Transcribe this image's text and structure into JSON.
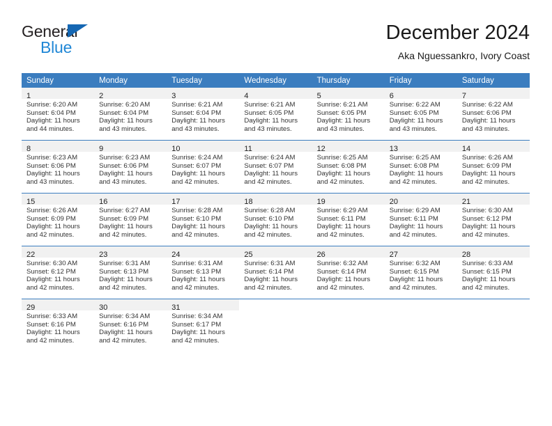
{
  "logo": {
    "word_one": "General",
    "word_two": "Blue",
    "triangle_color": "#1567b3",
    "blue_text_color": "#2087d6"
  },
  "header": {
    "title": "December 2024",
    "subtitle": "Aka Nguessankro, Ivory Coast"
  },
  "theme": {
    "header_blue": "#3b7dbf",
    "date_band_gray": "#f1f1f1",
    "text_dark": "#222222"
  },
  "calendar": {
    "weekday_headers": [
      "Sunday",
      "Monday",
      "Tuesday",
      "Wednesday",
      "Thursday",
      "Friday",
      "Saturday"
    ],
    "weeks": [
      [
        {
          "date": "1",
          "sunrise": "Sunrise: 6:20 AM",
          "sunset": "Sunset: 6:04 PM",
          "daylight_line1": "Daylight: 11 hours",
          "daylight_line2": "and 44 minutes."
        },
        {
          "date": "2",
          "sunrise": "Sunrise: 6:20 AM",
          "sunset": "Sunset: 6:04 PM",
          "daylight_line1": "Daylight: 11 hours",
          "daylight_line2": "and 43 minutes."
        },
        {
          "date": "3",
          "sunrise": "Sunrise: 6:21 AM",
          "sunset": "Sunset: 6:04 PM",
          "daylight_line1": "Daylight: 11 hours",
          "daylight_line2": "and 43 minutes."
        },
        {
          "date": "4",
          "sunrise": "Sunrise: 6:21 AM",
          "sunset": "Sunset: 6:05 PM",
          "daylight_line1": "Daylight: 11 hours",
          "daylight_line2": "and 43 minutes."
        },
        {
          "date": "5",
          "sunrise": "Sunrise: 6:21 AM",
          "sunset": "Sunset: 6:05 PM",
          "daylight_line1": "Daylight: 11 hours",
          "daylight_line2": "and 43 minutes."
        },
        {
          "date": "6",
          "sunrise": "Sunrise: 6:22 AM",
          "sunset": "Sunset: 6:05 PM",
          "daylight_line1": "Daylight: 11 hours",
          "daylight_line2": "and 43 minutes."
        },
        {
          "date": "7",
          "sunrise": "Sunrise: 6:22 AM",
          "sunset": "Sunset: 6:06 PM",
          "daylight_line1": "Daylight: 11 hours",
          "daylight_line2": "and 43 minutes."
        }
      ],
      [
        {
          "date": "8",
          "sunrise": "Sunrise: 6:23 AM",
          "sunset": "Sunset: 6:06 PM",
          "daylight_line1": "Daylight: 11 hours",
          "daylight_line2": "and 43 minutes."
        },
        {
          "date": "9",
          "sunrise": "Sunrise: 6:23 AM",
          "sunset": "Sunset: 6:06 PM",
          "daylight_line1": "Daylight: 11 hours",
          "daylight_line2": "and 43 minutes."
        },
        {
          "date": "10",
          "sunrise": "Sunrise: 6:24 AM",
          "sunset": "Sunset: 6:07 PM",
          "daylight_line1": "Daylight: 11 hours",
          "daylight_line2": "and 42 minutes."
        },
        {
          "date": "11",
          "sunrise": "Sunrise: 6:24 AM",
          "sunset": "Sunset: 6:07 PM",
          "daylight_line1": "Daylight: 11 hours",
          "daylight_line2": "and 42 minutes."
        },
        {
          "date": "12",
          "sunrise": "Sunrise: 6:25 AM",
          "sunset": "Sunset: 6:08 PM",
          "daylight_line1": "Daylight: 11 hours",
          "daylight_line2": "and 42 minutes."
        },
        {
          "date": "13",
          "sunrise": "Sunrise: 6:25 AM",
          "sunset": "Sunset: 6:08 PM",
          "daylight_line1": "Daylight: 11 hours",
          "daylight_line2": "and 42 minutes."
        },
        {
          "date": "14",
          "sunrise": "Sunrise: 6:26 AM",
          "sunset": "Sunset: 6:09 PM",
          "daylight_line1": "Daylight: 11 hours",
          "daylight_line2": "and 42 minutes."
        }
      ],
      [
        {
          "date": "15",
          "sunrise": "Sunrise: 6:26 AM",
          "sunset": "Sunset: 6:09 PM",
          "daylight_line1": "Daylight: 11 hours",
          "daylight_line2": "and 42 minutes."
        },
        {
          "date": "16",
          "sunrise": "Sunrise: 6:27 AM",
          "sunset": "Sunset: 6:09 PM",
          "daylight_line1": "Daylight: 11 hours",
          "daylight_line2": "and 42 minutes."
        },
        {
          "date": "17",
          "sunrise": "Sunrise: 6:28 AM",
          "sunset": "Sunset: 6:10 PM",
          "daylight_line1": "Daylight: 11 hours",
          "daylight_line2": "and 42 minutes."
        },
        {
          "date": "18",
          "sunrise": "Sunrise: 6:28 AM",
          "sunset": "Sunset: 6:10 PM",
          "daylight_line1": "Daylight: 11 hours",
          "daylight_line2": "and 42 minutes."
        },
        {
          "date": "19",
          "sunrise": "Sunrise: 6:29 AM",
          "sunset": "Sunset: 6:11 PM",
          "daylight_line1": "Daylight: 11 hours",
          "daylight_line2": "and 42 minutes."
        },
        {
          "date": "20",
          "sunrise": "Sunrise: 6:29 AM",
          "sunset": "Sunset: 6:11 PM",
          "daylight_line1": "Daylight: 11 hours",
          "daylight_line2": "and 42 minutes."
        },
        {
          "date": "21",
          "sunrise": "Sunrise: 6:30 AM",
          "sunset": "Sunset: 6:12 PM",
          "daylight_line1": "Daylight: 11 hours",
          "daylight_line2": "and 42 minutes."
        }
      ],
      [
        {
          "date": "22",
          "sunrise": "Sunrise: 6:30 AM",
          "sunset": "Sunset: 6:12 PM",
          "daylight_line1": "Daylight: 11 hours",
          "daylight_line2": "and 42 minutes."
        },
        {
          "date": "23",
          "sunrise": "Sunrise: 6:31 AM",
          "sunset": "Sunset: 6:13 PM",
          "daylight_line1": "Daylight: 11 hours",
          "daylight_line2": "and 42 minutes."
        },
        {
          "date": "24",
          "sunrise": "Sunrise: 6:31 AM",
          "sunset": "Sunset: 6:13 PM",
          "daylight_line1": "Daylight: 11 hours",
          "daylight_line2": "and 42 minutes."
        },
        {
          "date": "25",
          "sunrise": "Sunrise: 6:31 AM",
          "sunset": "Sunset: 6:14 PM",
          "daylight_line1": "Daylight: 11 hours",
          "daylight_line2": "and 42 minutes."
        },
        {
          "date": "26",
          "sunrise": "Sunrise: 6:32 AM",
          "sunset": "Sunset: 6:14 PM",
          "daylight_line1": "Daylight: 11 hours",
          "daylight_line2": "and 42 minutes."
        },
        {
          "date": "27",
          "sunrise": "Sunrise: 6:32 AM",
          "sunset": "Sunset: 6:15 PM",
          "daylight_line1": "Daylight: 11 hours",
          "daylight_line2": "and 42 minutes."
        },
        {
          "date": "28",
          "sunrise": "Sunrise: 6:33 AM",
          "sunset": "Sunset: 6:15 PM",
          "daylight_line1": "Daylight: 11 hours",
          "daylight_line2": "and 42 minutes."
        }
      ],
      [
        {
          "date": "29",
          "sunrise": "Sunrise: 6:33 AM",
          "sunset": "Sunset: 6:16 PM",
          "daylight_line1": "Daylight: 11 hours",
          "daylight_line2": "and 42 minutes."
        },
        {
          "date": "30",
          "sunrise": "Sunrise: 6:34 AM",
          "sunset": "Sunset: 6:16 PM",
          "daylight_line1": "Daylight: 11 hours",
          "daylight_line2": "and 42 minutes."
        },
        {
          "date": "31",
          "sunrise": "Sunrise: 6:34 AM",
          "sunset": "Sunset: 6:17 PM",
          "daylight_line1": "Daylight: 11 hours",
          "daylight_line2": "and 42 minutes."
        },
        {
          "date": "",
          "sunrise": "",
          "sunset": "",
          "daylight_line1": "",
          "daylight_line2": ""
        },
        {
          "date": "",
          "sunrise": "",
          "sunset": "",
          "daylight_line1": "",
          "daylight_line2": ""
        },
        {
          "date": "",
          "sunrise": "",
          "sunset": "",
          "daylight_line1": "",
          "daylight_line2": ""
        },
        {
          "date": "",
          "sunrise": "",
          "sunset": "",
          "daylight_line1": "",
          "daylight_line2": ""
        }
      ]
    ]
  }
}
